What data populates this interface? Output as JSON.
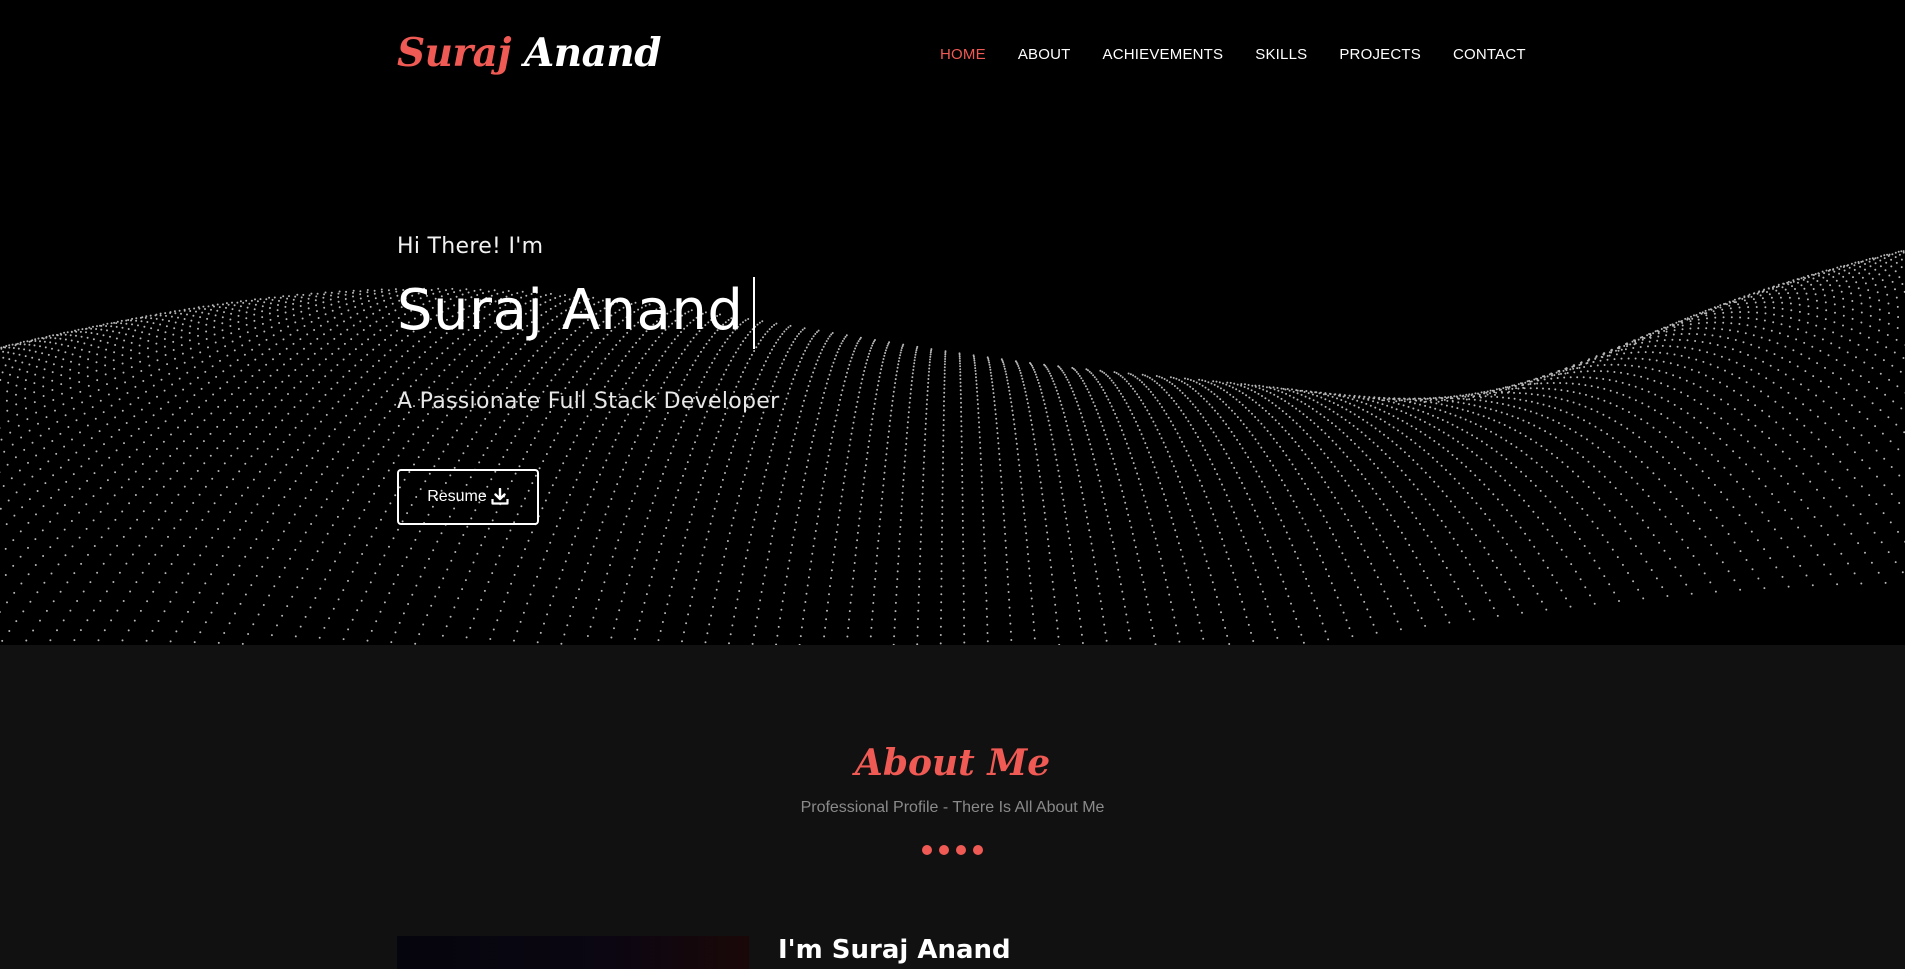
{
  "brand": {
    "first": "Suraj",
    "last": "Anand"
  },
  "nav": [
    {
      "label": "HOME",
      "active": true
    },
    {
      "label": "ABOUT",
      "active": false
    },
    {
      "label": "ACHIEVEMENTS",
      "active": false
    },
    {
      "label": "SKILLS",
      "active": false
    },
    {
      "label": "PROJECTS",
      "active": false
    },
    {
      "label": "CONTACT",
      "active": false
    }
  ],
  "hero": {
    "greeting": "Hi There! I'm",
    "name": "Suraj Anand",
    "tagline": "A Passionate Full Stack Developer",
    "resume_label": "Resume",
    "resume_icon": "download-icon"
  },
  "about": {
    "title": "About Me",
    "subtitle": "Professional Profile - There Is All About Me",
    "heading": "I'm Suraj Anand"
  },
  "colors": {
    "accent": "#f05a54",
    "hero_bg": "#000000",
    "about_bg": "#111111",
    "muted_text": "#8a8a8a"
  }
}
